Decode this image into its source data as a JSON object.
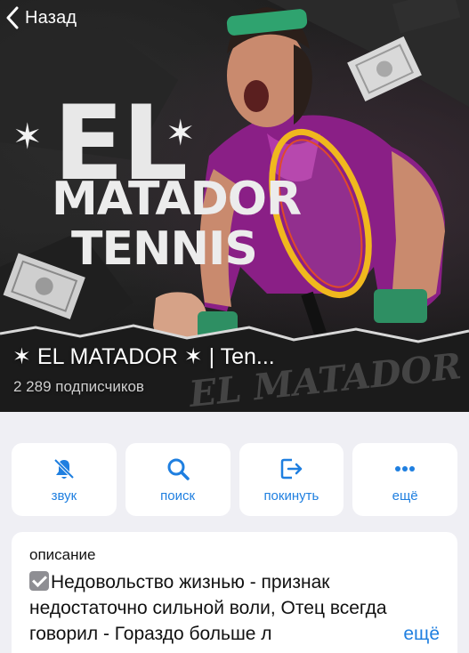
{
  "nav": {
    "back_label": "Назад"
  },
  "cover": {
    "logo_line1": "EL",
    "logo_line2": "MATADOR",
    "logo_line3": "TENNIS",
    "star_glyph": "✶",
    "watermark": "EL MATADOR"
  },
  "channel": {
    "title": "✶ EL MATADOR ✶ | Ten...",
    "subscribers": "2 289 подписчиков"
  },
  "actions": [
    {
      "label": "звук",
      "icon": "bell-slash-icon"
    },
    {
      "label": "поиск",
      "icon": "search-icon"
    },
    {
      "label": "покинуть",
      "icon": "leave-icon"
    },
    {
      "label": "ещё",
      "icon": "more-dots-icon"
    }
  ],
  "description": {
    "label": "описание",
    "checkbox_icon": "check-box-icon",
    "text": "Недовольство жизнью - признак недостаточно сильной воли, Отец всегда говорил - Гораздо больше л",
    "more_link": "ещё"
  },
  "colors": {
    "accent": "#1f7fe0",
    "background": "#efeff4",
    "card": "#ffffff"
  }
}
